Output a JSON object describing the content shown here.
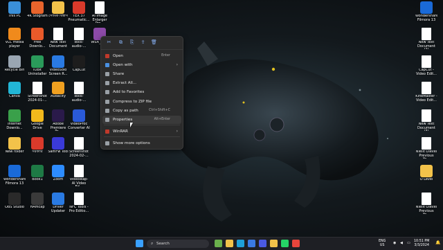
{
  "desktop": {
    "left_icons": [
      {
        "label": "This PC",
        "icon": "monitor-icon",
        "color": "#3a8fd8"
      },
      {
        "label": "4K Stogram",
        "icon": "stogram-icon",
        "color": "#e8642c"
      },
      {
        "label": "সৌমিক বিশ্বাস",
        "icon": "folder-icon",
        "color": "#f2c24a"
      },
      {
        "label": "TEX 37 Pneumatic...",
        "icon": "pdf-icon",
        "color": "#d93a2b"
      },
      {
        "label": "AI Image Enlarger Pro...",
        "icon": "document-icon",
        "color": "#ffffff"
      },
      {
        "label": "VLC media player",
        "icon": "vlc-icon",
        "color": "#f08a1c"
      },
      {
        "label": "Free Downlo...",
        "icon": "download-icon",
        "color": "#e85a2a"
      },
      {
        "label": "New Text Document",
        "icon": "document-icon",
        "color": "#ffffff"
      },
      {
        "label": "lexis-audio-...",
        "icon": "document-icon",
        "color": "#ffffff"
      },
      {
        "label": "WSA_21...",
        "icon": "winrar-icon",
        "color": "#8c4aa8"
      },
      {
        "label": "Recycle Bin",
        "icon": "recycle-bin-icon",
        "color": "#9aa6b2"
      },
      {
        "label": "IObit Uninstaller",
        "icon": "iobit-icon",
        "color": "#2a9a5a"
      },
      {
        "label": "VideoSolo Screen R...",
        "icon": "videosolo-icon",
        "color": "#2a7ae2"
      },
      {
        "label": "CapCut",
        "icon": "capcut-icon",
        "color": "#1d1d1d"
      },
      {
        "label": "Canva",
        "icon": "canva-icon",
        "color": "#22b6d6"
      },
      {
        "label": "Screenshot 2024-01-...",
        "icon": "image-icon",
        "color": "#ffffff"
      },
      {
        "label": "Audacity",
        "icon": "audacity-icon",
        "color": "#f0a020"
      },
      {
        "label": "lexis-audio-...",
        "icon": "document-icon",
        "color": "#ffffff"
      },
      {
        "label": "Internet Downlo...",
        "icon": "idm-icon",
        "color": "#3aa04a"
      },
      {
        "label": "Google Drive",
        "icon": "google-drive-icon",
        "color": "#f2b91c"
      },
      {
        "label": "Adobe Premiere Pr...",
        "icon": "premiere-icon",
        "color": "#2a1a4a"
      },
      {
        "label": "VideoProc Converter AI",
        "icon": "videoproc-icon",
        "color": "#2a5ad8"
      },
      {
        "label": "New folder",
        "icon": "folder-icon",
        "color": "#f2c24a"
      },
      {
        "label": "সরকারি",
        "icon": "pdf-icon",
        "color": "#d93a2b"
      },
      {
        "label": "SamFw Tool",
        "icon": "samfw-icon",
        "color": "#3a3ad8"
      },
      {
        "label": "Screenshot 2024-02-...",
        "icon": "image-icon",
        "color": "#ffffff"
      },
      {
        "label": "Wondershare Filmora 13",
        "icon": "filmora-icon",
        "color": "#1a6ad8"
      },
      {
        "label": "Book1",
        "icon": "excel-icon",
        "color": "#1e7a45"
      },
      {
        "label": "Zoom",
        "icon": "zoom-icon",
        "color": "#2d8cff"
      },
      {
        "label": "Videoleap- AI Video Ed...",
        "icon": "document-icon",
        "color": "#ffffff"
      },
      {
        "label": "OBS Studio",
        "icon": "obs-icon",
        "color": "#2a2a2a"
      },
      {
        "label": "HAmcap",
        "icon": "hamcap-icon",
        "color": "#3a3a3a"
      },
      {
        "label": "Driver Updater",
        "icon": "driver-updater-icon",
        "color": "#2a7ae2"
      },
      {
        "label": "NFC Tools - Pro Editio...",
        "icon": "document-icon",
        "color": "#ffffff"
      }
    ],
    "right_icons": [
      {
        "label": "Wondershare Filmora 13",
        "icon": "filmora-icon",
        "color": "#1a6ad8"
      },
      {
        "label": "New Text Document (2)",
        "icon": "document-icon",
        "color": "#ffffff"
      },
      {
        "label": "CapCut - Video Edit...",
        "icon": "document-icon",
        "color": "#ffffff"
      },
      {
        "label": "KineMaster - Video Edit...",
        "icon": "document-icon",
        "color": "#ffffff"
      },
      {
        "label": "New Text Document (3)",
        "icon": "document-icon",
        "color": "#ffffff"
      },
      {
        "label": "NielIt Olevel Previous Ye...",
        "icon": "document-icon",
        "color": "#ffffff"
      },
      {
        "label": "O Level",
        "icon": "folder-icon",
        "color": "#f2c24a"
      },
      {
        "label": "NielIt Olevel Previous Ye...",
        "icon": "document-icon",
        "color": "#ffffff"
      }
    ]
  },
  "context_menu": {
    "toolbar": [
      {
        "icon": "cut-icon",
        "glyph": "✂"
      },
      {
        "icon": "copy-icon",
        "glyph": "⧉"
      },
      {
        "icon": "rename-icon",
        "glyph": "⎘"
      },
      {
        "icon": "share-icon",
        "glyph": "⇪"
      },
      {
        "icon": "delete-icon",
        "glyph": "🗑"
      }
    ],
    "items": [
      {
        "label": "Open",
        "shortcut": "Enter",
        "submenu": false,
        "icon": "winrar-icon",
        "color": "#c0392b"
      },
      {
        "label": "Open with",
        "shortcut": "",
        "submenu": true,
        "icon": "open-with-icon",
        "color": "#4a90e2"
      },
      {
        "label": "Share",
        "shortcut": "",
        "submenu": false,
        "icon": "share-icon",
        "color": "#9aa0a6"
      },
      {
        "label": "Extract All...",
        "shortcut": "",
        "submenu": false,
        "icon": "extract-icon",
        "color": "#9aa0a6"
      },
      {
        "label": "Add to Favorites",
        "shortcut": "",
        "submenu": false,
        "icon": "star-icon",
        "color": "#9aa0a6"
      },
      {
        "label": "Compress to ZIP file",
        "shortcut": "",
        "submenu": false,
        "icon": "zip-icon",
        "color": "#9aa0a6"
      },
      {
        "label": "Copy as path",
        "shortcut": "Ctrl+Shift+C",
        "submenu": false,
        "icon": "copy-path-icon",
        "color": "#9aa0a6"
      },
      {
        "label": "Properties",
        "shortcut": "Alt+Enter",
        "submenu": false,
        "icon": "properties-icon",
        "color": "#9aa0a6"
      },
      {
        "label": "WinRAR",
        "shortcut": "",
        "submenu": true,
        "icon": "winrar-icon",
        "color": "#c0392b"
      },
      {
        "label": "Show more options",
        "shortcut": "",
        "submenu": false,
        "icon": "more-options-icon",
        "color": "#9aa0a6"
      }
    ]
  },
  "taskbar": {
    "search_placeholder": "Search",
    "apps": [
      {
        "icon": "start-icon",
        "color": "#3aa0ff"
      },
      {
        "icon": "widgets-icon",
        "color": "#6ab04c"
      },
      {
        "icon": "file-explorer-icon",
        "color": "#f2c24a"
      },
      {
        "icon": "edge-icon",
        "color": "#1fa0d8"
      },
      {
        "icon": "mail-icon",
        "color": "#3a7ae2"
      },
      {
        "icon": "store-icon",
        "color": "#4a5ae2"
      },
      {
        "icon": "files-icon",
        "color": "#f2c24a"
      },
      {
        "icon": "whatsapp-icon",
        "color": "#25d366"
      },
      {
        "icon": "chrome-icon",
        "color": "#e8453c"
      }
    ],
    "language_top": "ENG",
    "language_bottom": "US",
    "time": "10:51 PM",
    "date": "3/3/2024"
  }
}
